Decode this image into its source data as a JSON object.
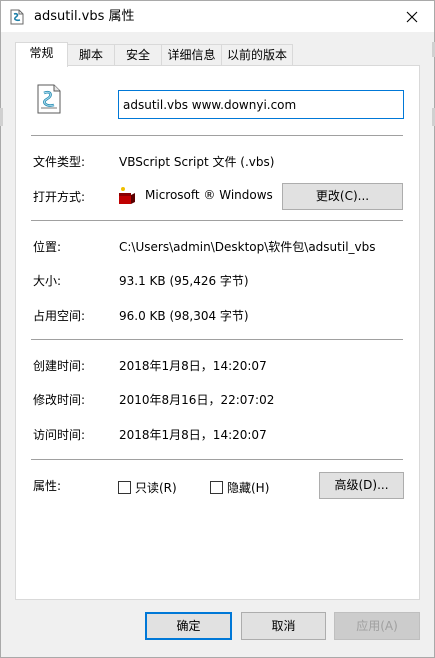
{
  "window": {
    "title": "adsutil.vbs 属性",
    "close_glyph": "✕"
  },
  "tabs": [
    {
      "label": "常规",
      "active": true
    },
    {
      "label": "脚本",
      "active": false
    },
    {
      "label": "安全",
      "active": false
    },
    {
      "label": "详细信息",
      "active": false
    },
    {
      "label": "以前的版本",
      "active": false
    }
  ],
  "general": {
    "file_name": "adsutil.vbs www.downyi.com",
    "file_icon": "vbs-script-file-icon",
    "type_label": "文件类型:",
    "type_value": "VBScript Script 文件 (.vbs)",
    "open_with_label": "打开方式:",
    "open_with_value": "Microsoft ® Windows",
    "open_with_icon": "windows-script-host-icon",
    "change_button": "更改(C)...",
    "location_label": "位置:",
    "location_value": "C:\\Users\\admin\\Desktop\\软件包\\adsutil_vbs",
    "size_label": "大小:",
    "size_value": "93.1 KB (95,426 字节)",
    "size_on_disk_label": "占用空间:",
    "size_on_disk_value": "96.0 KB (98,304 字节)",
    "created_label": "创建时间:",
    "created_value": "2018年1月8日，14:20:07",
    "modified_label": "修改时间:",
    "modified_value": "2010年8月16日，22:07:02",
    "accessed_label": "访问时间:",
    "accessed_value": "2018年1月8日，14:20:07",
    "attributes_label": "属性:",
    "readonly_label": "只读(R)",
    "readonly_checked": false,
    "hidden_label": "隐藏(H)",
    "hidden_checked": false,
    "advanced_button": "高级(D)..."
  },
  "footer": {
    "ok": "确定",
    "cancel": "取消",
    "apply": "应用(A)"
  },
  "colors": {
    "focus_border": "#0078d7",
    "dialog_bg": "#f0f0f0",
    "panel_bg": "#ffffff",
    "separator": "#a0a0a0"
  }
}
